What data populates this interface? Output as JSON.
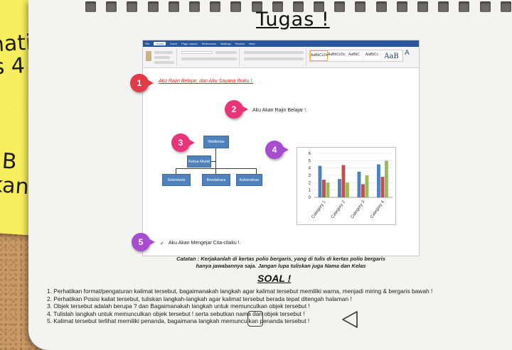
{
  "sticky_notes": {
    "note1_lines": [
      "natika",
      "s 4"
    ],
    "note2_lines": [
      "B",
      "kan"
    ]
  },
  "slide_title": "Tugas !",
  "word_doc": {
    "ribbon_tabs": [
      "File",
      "Home",
      "Insert",
      "Page Layout",
      "References",
      "Mailings",
      "Review",
      "View"
    ],
    "styles": [
      "AaBbCcDc",
      "AaBbCcDc",
      "AaBbC",
      "AaBbCc",
      "AaB"
    ],
    "line1": "Aku Rajin Belajar, dan Aku Sayang Ibuku !.",
    "line2": "Aku Akan Rajin Belajar !.",
    "line5": "Aku Akan Mengejar Cita-citaku !.",
    "checkmark": "✓",
    "org_chart": {
      "top": "Walikelas",
      "middle": "Ketua Murid",
      "bottom": [
        "Sekretaris",
        "Bendahara",
        "Kebersihan"
      ]
    },
    "badges": [
      "1",
      "2",
      "3",
      "4",
      "5"
    ]
  },
  "chart_data": {
    "type": "bar",
    "categories": [
      "Category 1",
      "Category 2",
      "Category 3",
      "Category 4"
    ],
    "series": [
      {
        "color": "#4f81bd",
        "values": [
          4.3,
          2.5,
          3.5,
          4.5
        ]
      },
      {
        "color": "#c0504d",
        "values": [
          2.4,
          4.4,
          1.8,
          2.8
        ]
      },
      {
        "color": "#9bbb59",
        "values": [
          2.0,
          2.0,
          3.0,
          5.0
        ]
      }
    ],
    "yticks": [
      "0",
      "1",
      "2",
      "3",
      "4",
      "5",
      "6"
    ],
    "ylim": [
      0,
      6
    ]
  },
  "catatan": [
    "Catatan : Kerjakanlah di kertas polio bergaris, yang di tulis di kertas polio bergaris",
    "hanya jawabannya saja. Jangan lupa tuliskan juga Nama dan Kelas"
  ],
  "soal_title": "SOAL !",
  "questions": [
    "1. Perhatikan format/pengaturan kalimat tersebut, bagaimanakah langkah agar kalimat tersebut memiliki warna, menjadi miring & bergaris bawah !",
    "2. Perhatikan Posisi kaliat tersebut, tuliskan langkah-langkah agar kalimat tersebut berada tepat ditengah halaman !",
    "3. Objek tersebut adalah berupa ? dan Bagaimanakah langkah untuk memunculkan objek tersebut !",
    "4. Tulislah langkah untuk memunculkan objek tersebut ! serta sebutkan nama dari objek tersebut !",
    "5. Kalimat tersebut terlihat memiliki penanda, bagaimana langkah memunculkan penanda tersebut !"
  ]
}
